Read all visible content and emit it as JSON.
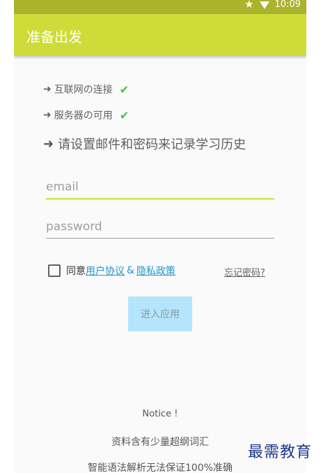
{
  "status_bar": {
    "time": "10:09",
    "icons": [
      "star-icon",
      "wifi-icon"
    ]
  },
  "app_bar": {
    "title": "准备出发"
  },
  "checks": [
    {
      "label": "互联网の连接",
      "icon": "check-icon"
    },
    {
      "label": "服务器の可用",
      "icon": "check-icon"
    }
  ],
  "instruction": "请设置邮件和密码来记录学习历史",
  "form": {
    "email_placeholder": "email",
    "password_placeholder": "password",
    "agree_prefix": "同意",
    "user_agreement": "用户协议",
    "ampersand": "&",
    "privacy_policy": "隐私政策",
    "forgot_password": "忘记密码?",
    "enter_button": "进入应用"
  },
  "notice": {
    "title": "Notice !",
    "line1": "资料含有少量超纲词汇",
    "line2": "智能语法解析无法保证100%准确"
  },
  "watermark": "最需教育",
  "colors": {
    "status_bar": "#aab32c",
    "app_bar": "#cddc39",
    "tick": "#2ecc40",
    "link": "#2196c9",
    "button": "#b3e5fc"
  }
}
